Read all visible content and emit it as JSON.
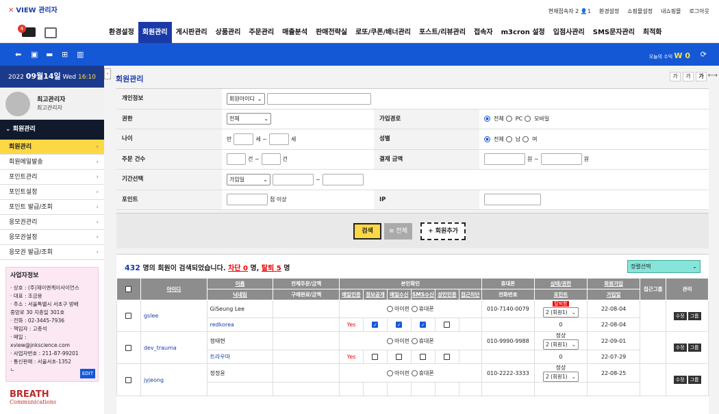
{
  "logo": {
    "mark": "✕",
    "text": "VIEW 관리자"
  },
  "toplinks": {
    "current_label": "현재접속자 2",
    "current_count": "1",
    "items": [
      "환경설정",
      "쇼핑몰설정",
      "내쇼핑몰",
      "로그아웃"
    ]
  },
  "mainnav": {
    "badge": "4",
    "items": [
      "환경설정",
      "회원관리",
      "게시판관리",
      "상품관리",
      "주문관리",
      "매출분석",
      "판매전략실",
      "로또/쿠폰/배너관리",
      "포스트/리뷰관리",
      "접속자",
      "m3cron 설정",
      "입점사관리",
      "SMS문자관리",
      "최적화"
    ],
    "active": 1
  },
  "bluebar": {
    "earn_label": "오늘의 수익",
    "earn_value": "W 0"
  },
  "sidebar": {
    "date_prefix": "2022",
    "date_main": "09월14일",
    "date_day": "Wed",
    "time": "16:10",
    "user_name": "최고관리자",
    "user_role": "최고관리자",
    "menu_head": "회원관리",
    "items": [
      "회원관리",
      "회원메일발송",
      "포인트관리",
      "포인트설정",
      "포인트 발급/조회",
      "응모권관리",
      "응모권설정",
      "응모권 발급/조회"
    ],
    "active": 0,
    "biz_title": "사업자정보",
    "biz_lines": [
      "· 상호 : (주)제이앤케이사이언스",
      "· 대표 : 조금용",
      "· 주소 : 서울특별시 서초구 방배",
      "중앙로 30 지층일 301호",
      "· 전화 : 02-3445-7936",
      "· 책임자 : 고종석",
      "· 메일 :",
      "xview@jnkscience.com",
      "· 사업자번호 : 211-87-99201",
      "· 통신판매 : 서울서초-1352",
      "ㄴ"
    ],
    "edit_label": "EDIT",
    "brand_main": "BREATH",
    "brand_sub": "Communications"
  },
  "content": {
    "title": "회원관리",
    "font_buttons": [
      "가",
      "가",
      "가"
    ]
  },
  "form": {
    "personal_label": "개인정보",
    "personal_select": "회원아이디",
    "auth_label": "권한",
    "auth_select": "전체",
    "join_path_label": "가입경로",
    "join_path_opts": [
      "전체",
      "PC",
      "모바일"
    ],
    "age_label": "나이",
    "age_prefix": "만",
    "age_unit1": "세 ~",
    "age_unit2": "세",
    "gender_label": "성별",
    "gender_opts": [
      "전체",
      "남",
      "여"
    ],
    "order_label": "주문 건수",
    "order_unit1": "건 ~",
    "order_unit2": "건",
    "pay_label": "결제 금액",
    "pay_unit1": "원 ~",
    "pay_unit2": "원",
    "period_label": "기간선택",
    "period_select": "가입일",
    "period_sep": "~",
    "point_label": "포인트",
    "point_unit": "점 이상",
    "ip_label": "IP"
  },
  "buttons": {
    "search": "검색",
    "all": "≡ 전체",
    "add": "+ 회원추가"
  },
  "results": {
    "count": "432",
    "text1": "명의 회원이 검색되었습니다.",
    "blocked_label": "차단 0",
    "text2": "명,",
    "withdrawn_label": "탈퇴 5",
    "text3": "명",
    "sort_label": "정렬선택"
  },
  "table": {
    "h1": {
      "id": "아이디",
      "name": "이름",
      "total_order": "전체주문/금액",
      "verify": "본인확인",
      "phone": "휴대폰",
      "status": "상태/권한",
      "join": "회원가입",
      "group": "접근그룹",
      "manage": "관리"
    },
    "h2": {
      "nick": "닉네임",
      "buy_done": "구매완료/금액",
      "c1": "메일인증",
      "c2": "정보공개",
      "c3": "메일수신",
      "c4": "SMS수신",
      "c5": "성인인증",
      "c6": "접근차단",
      "tel": "전화번호",
      "point": "포인트",
      "last": "가입일"
    },
    "verify_opts": [
      "아이핀",
      "휴대폰"
    ],
    "grade_select": "2 (회원1)",
    "btn_edit": "수정",
    "btn_group": "그룹",
    "rows": [
      {
        "id": "gslee",
        "name": "GiSeung Lee",
        "nick": "redkorea",
        "yes": "Yes",
        "checks": [
          true,
          true,
          true,
          false
        ],
        "phone": "010-7140-0079",
        "status": "탈퇴함",
        "point": "0",
        "join": "22-08-04",
        "last": "22-08-04"
      },
      {
        "id": "dev_trauma",
        "name": "정태현",
        "nick": "트라우마",
        "yes": "Yes",
        "checks": [
          false,
          false,
          false,
          false
        ],
        "phone": "010-9990-9988",
        "status": "정상",
        "point": "0",
        "join": "22-09-01",
        "last": "22-07-29"
      },
      {
        "id": "jyjeong",
        "name": "정정윤",
        "nick": "",
        "yes": "",
        "checks": [],
        "phone": "010-2222-3333",
        "status": "정상",
        "point": "",
        "join": "22-08-25",
        "last": ""
      }
    ]
  },
  "colors": {
    "primary": "#1558d6",
    "nav_active": "#1a3aa8",
    "highlight": "#fcd845",
    "danger": "#e23a2e"
  }
}
